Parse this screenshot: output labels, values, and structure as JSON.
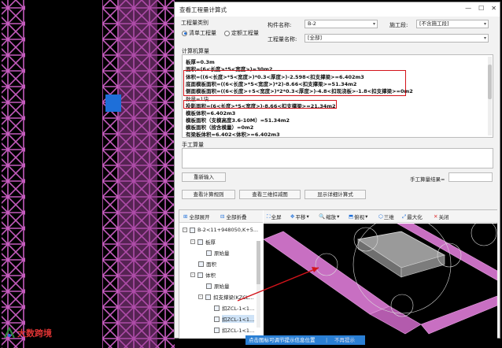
{
  "window": {
    "title": "查看工程量计算式"
  },
  "qty_type": {
    "label": "工程量类别",
    "options": [
      {
        "label": "清单工程量",
        "selected": true
      },
      {
        "label": "定额工程量",
        "selected": false
      }
    ]
  },
  "component": {
    "name_label": "构件名称:",
    "name_value": "B-2",
    "work_label": "施工段:",
    "work_value": "[不含施工段]",
    "qty_name_label": "工程量名称:",
    "qty_name_value": "[全部]"
  },
  "machine": {
    "label": "计算机算量",
    "lines": [
      "板厚=0.3m",
      "面积=(6<长度>*5<宽度>)=30m2",
      "体积=((6<长度>*5<宽度>)*0.3<厚度>)-2.598<扣支撑梁>=6.402m3",
      "底面模板面积=((6<长度>*5<宽度>)*2)-8.66<扣支撑梁>=51.34m2",
      "侧面模板面积=((6<长度>+5<宽度>)*2*0.3<厚度>)-4.8<扣现浇板>-1.8<扣支撑梁>=0m2",
      "数量=1块",
      "投影面积=(6<长度>*5<宽度>)-8.66<扣支撑梁>=21.34m2",
      "模板体积=6.402m3",
      "模板面积（支模高度3.6-10M）=51.34m2",
      "模板面积（按含模量）=0m2",
      "有梁板体积=6.402<体积>=6.402m3"
    ]
  },
  "manual": {
    "label": "手工算量",
    "reenter_button": "重新输入",
    "result_label": "手工算量结果="
  },
  "actions": {
    "rules_button": "查看计算规则",
    "view3d_button": "查看三维扣减图",
    "detail_button": "显示详细计算式"
  },
  "tree_toolbar": {
    "expand_all": "全部展开",
    "collapse_all": "全部折叠"
  },
  "tree": [
    {
      "label": "B-2<11+948050,K+5...",
      "level": 0,
      "toggle": "-"
    },
    {
      "label": "板厚",
      "level": 1,
      "toggle": "-"
    },
    {
      "label": "原始量",
      "level": 2,
      "toggle": ""
    },
    {
      "label": "面积",
      "level": 1,
      "toggle": ""
    },
    {
      "label": "体积",
      "level": 1,
      "toggle": "-"
    },
    {
      "label": "原始量",
      "level": 2,
      "toggle": ""
    },
    {
      "label": "扣支撑梁(KZCL...",
      "level": 2,
      "toggle": "-"
    },
    {
      "label": "扣ZCL-1<1...",
      "level": 3,
      "toggle": ""
    },
    {
      "label": "扣ZCL-1<1...",
      "level": 3,
      "toggle": "",
      "selected": true
    },
    {
      "label": "扣ZCL-1<1...",
      "level": 3,
      "toggle": ""
    }
  ],
  "view_toolbar": [
    "全屏",
    "平移",
    "缩放",
    "俯视",
    "三维",
    "最大化",
    "关闭"
  ],
  "tooltip": {
    "text": "点击图标可调节提示信息位置",
    "close": "不再提示"
  },
  "logo": {
    "text": "大数跨境"
  },
  "colors": {
    "accent": "#1e6fd9",
    "highlight": "#d3131a",
    "model_pink": "#d77fd0"
  }
}
